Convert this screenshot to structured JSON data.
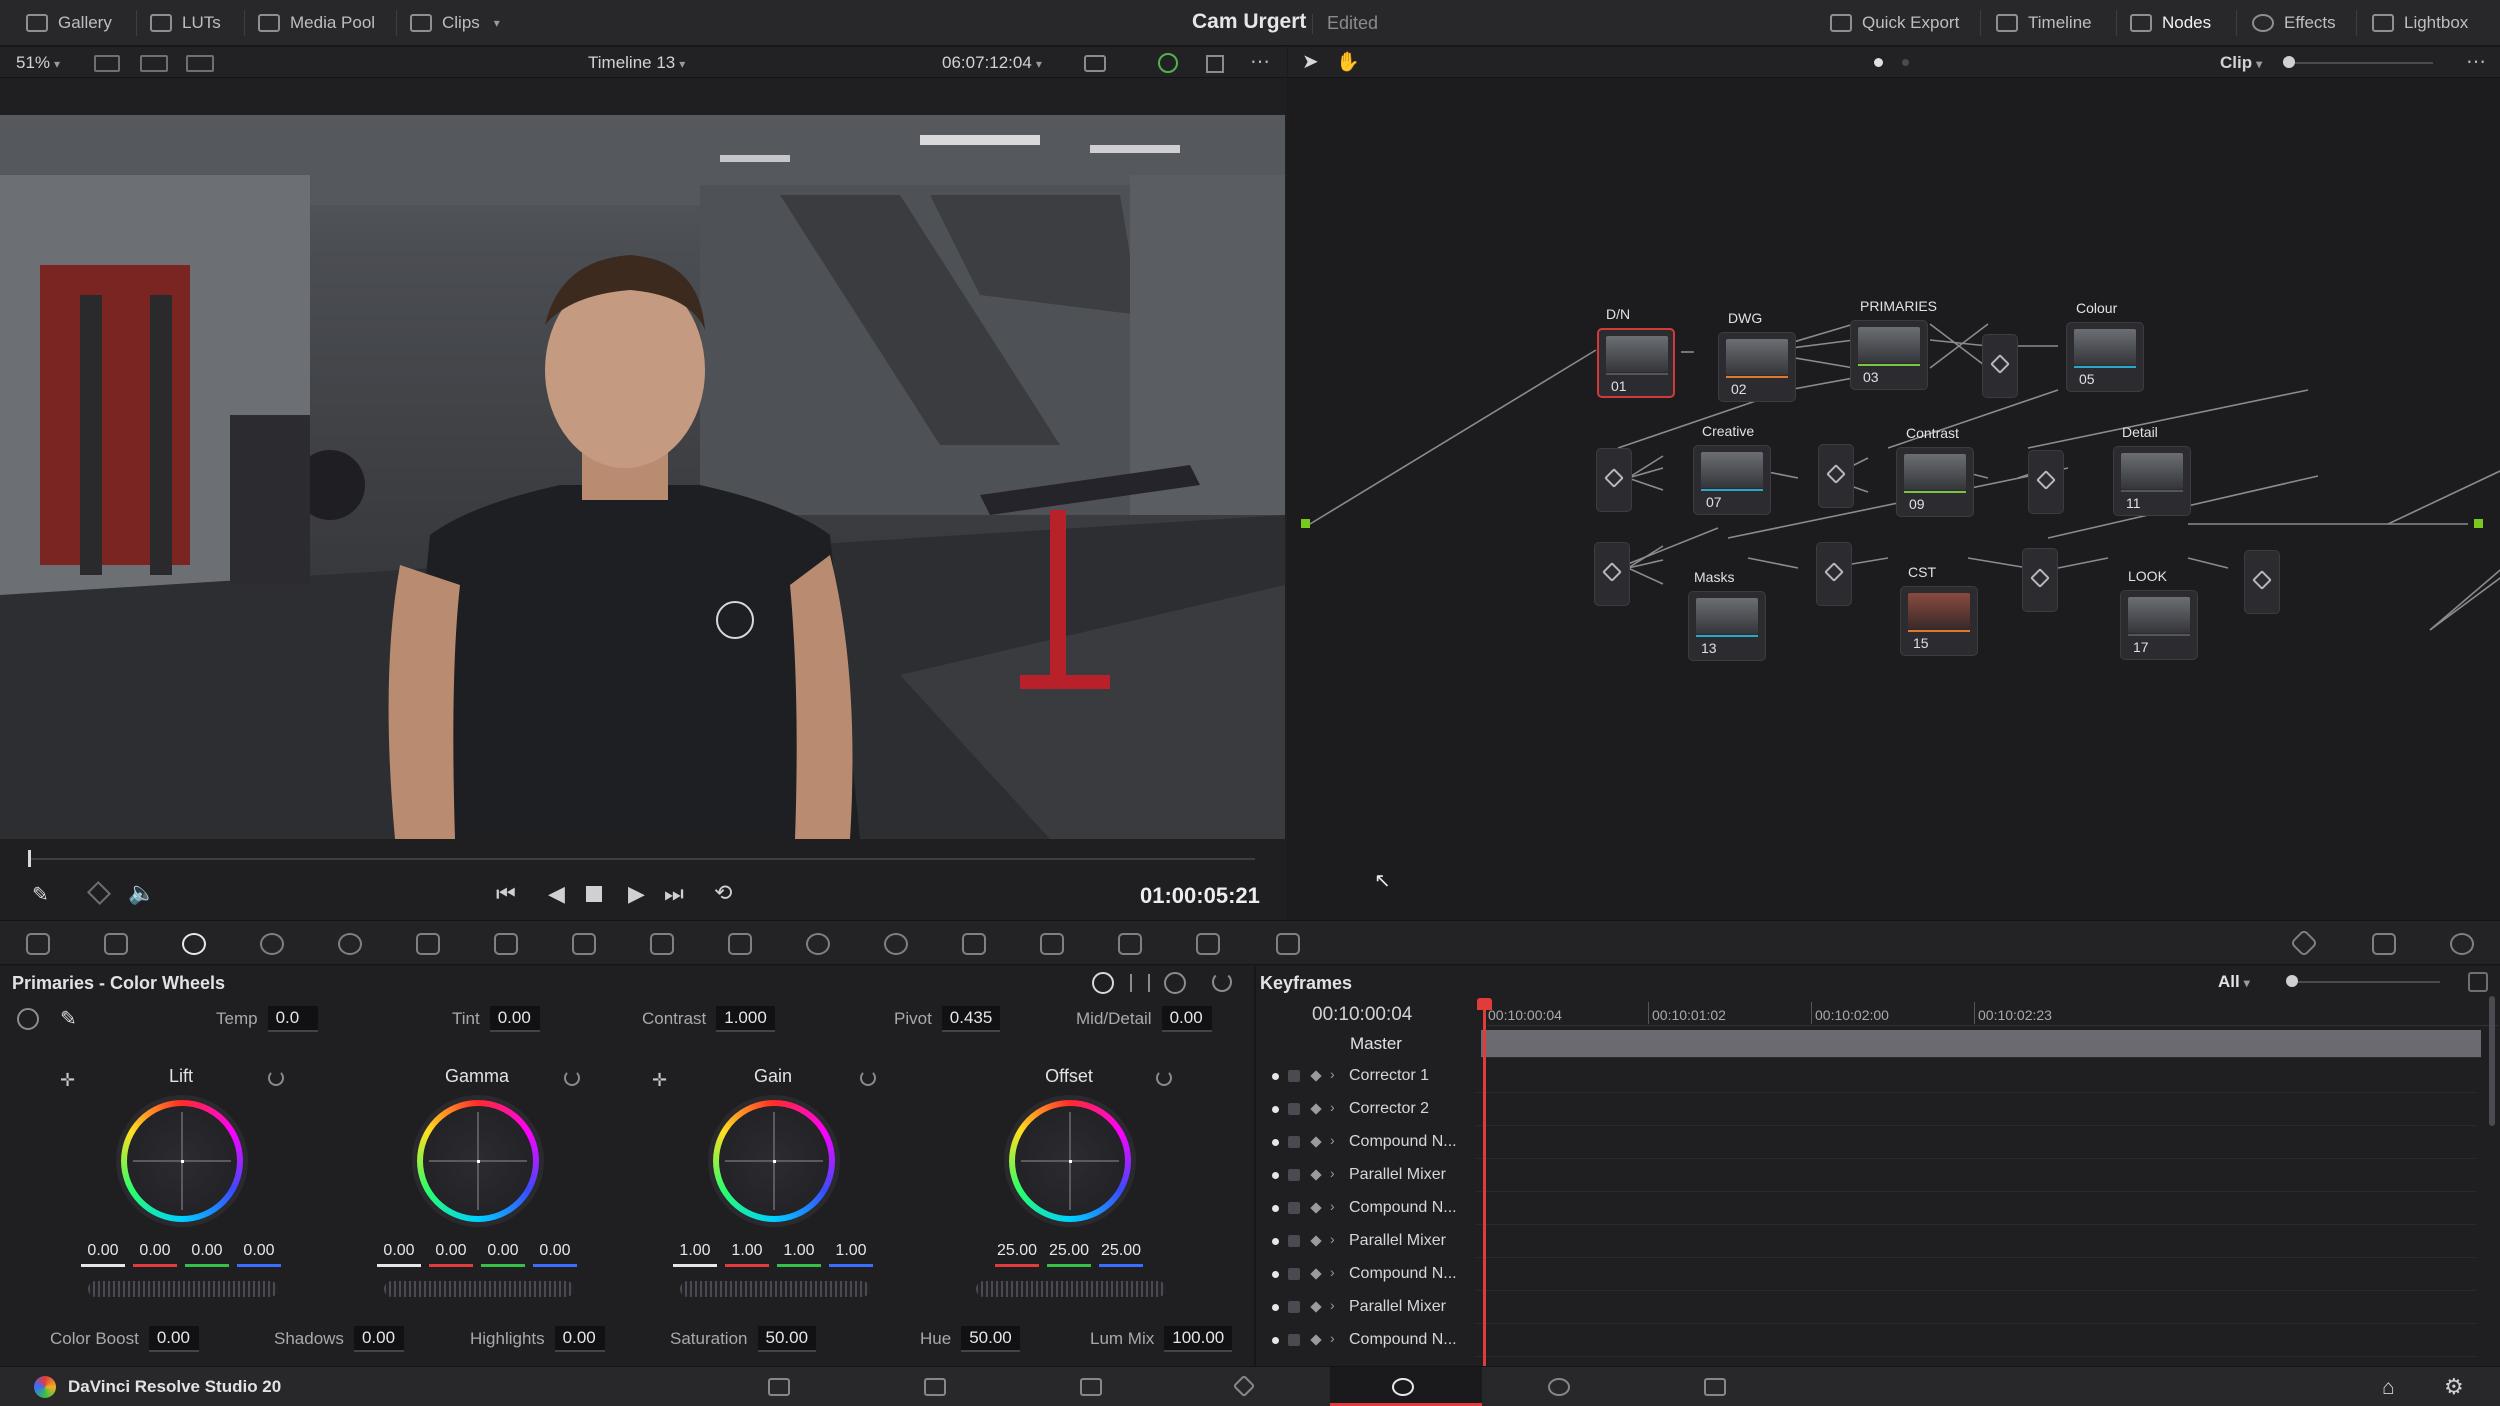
{
  "header": {
    "left_items": [
      {
        "label": "Gallery",
        "icon": "gallery-icon"
      },
      {
        "label": "LUTs",
        "icon": "luts-icon"
      },
      {
        "label": "Media Pool",
        "icon": "media-pool-icon"
      },
      {
        "label": "Clips",
        "icon": "clips-icon"
      }
    ],
    "project_title": "Cam Urgert",
    "status": "Edited",
    "right_items": [
      {
        "label": "Quick Export",
        "icon": "export-icon"
      },
      {
        "label": "Timeline",
        "icon": "timeline-icon"
      },
      {
        "label": "Nodes",
        "icon": "nodes-icon"
      },
      {
        "label": "Effects",
        "icon": "fx-icon"
      },
      {
        "label": "Lightbox",
        "icon": "lightbox-icon"
      }
    ]
  },
  "viewer": {
    "zoom": "51%",
    "timeline_name": "Timeline 13",
    "source_timecode": "06:07:12:04",
    "timecode": "01:00:05:21"
  },
  "node_editor": {
    "mode": "Clip",
    "nodes": [
      {
        "num": "01",
        "label": "D/N"
      },
      {
        "num": "02",
        "label": "DWG"
      },
      {
        "num": "03",
        "label": "PRIMARIES"
      },
      {
        "num": "05",
        "label": "Colour"
      },
      {
        "num": "07",
        "label": "Creative"
      },
      {
        "num": "09",
        "label": "Contrast"
      },
      {
        "num": "11",
        "label": "Detail"
      },
      {
        "num": "13",
        "label": "Masks"
      },
      {
        "num": "15",
        "label": "CST"
      },
      {
        "num": "17",
        "label": "LOOK"
      }
    ]
  },
  "primaries": {
    "title": "Primaries - Color Wheels",
    "top_params": [
      {
        "label": "Temp",
        "value": "0.0"
      },
      {
        "label": "Tint",
        "value": "0.00"
      },
      {
        "label": "Contrast",
        "value": "1.000"
      },
      {
        "label": "Pivot",
        "value": "0.435"
      },
      {
        "label": "Mid/Detail",
        "value": "0.00"
      }
    ],
    "wheels": [
      {
        "name": "Lift",
        "values": [
          "0.00",
          "0.00",
          "0.00",
          "0.00"
        ]
      },
      {
        "name": "Gamma",
        "values": [
          "0.00",
          "0.00",
          "0.00",
          "0.00"
        ]
      },
      {
        "name": "Gain",
        "values": [
          "1.00",
          "1.00",
          "1.00",
          "1.00"
        ]
      },
      {
        "name": "Offset",
        "values": [
          "25.00",
          "25.00",
          "25.00"
        ]
      }
    ],
    "bottom_params": [
      {
        "label": "Color Boost",
        "value": "0.00"
      },
      {
        "label": "Shadows",
        "value": "0.00"
      },
      {
        "label": "Highlights",
        "value": "0.00"
      },
      {
        "label": "Saturation",
        "value": "50.00"
      },
      {
        "label": "Hue",
        "value": "50.00"
      },
      {
        "label": "Lum Mix",
        "value": "100.00"
      }
    ]
  },
  "keyframes": {
    "title": "Keyframes",
    "filter": "All",
    "timecode": "00:10:00:04",
    "ruler": [
      "00:10:00:04",
      "00:10:01:02",
      "00:10:02:00",
      "00:10:02:23"
    ],
    "master_label": "Master",
    "tracks": [
      "Corrector 1",
      "Corrector 2",
      "Compound N...",
      "Parallel Mixer",
      "Compound N...",
      "Parallel Mixer",
      "Compound N...",
      "Parallel Mixer",
      "Compound N..."
    ]
  },
  "footer": {
    "app_name": "DaVinci Resolve Studio 20",
    "pages": [
      "media-page-icon",
      "cut-page-icon",
      "edit-page-icon",
      "fusion-page-icon",
      "color-page-icon",
      "fairlight-page-icon",
      "deliver-page-icon"
    ]
  },
  "colors": {
    "accent": "#e23b3b",
    "node_port": "#78c81e",
    "panel_bg": "#1f1f22"
  }
}
